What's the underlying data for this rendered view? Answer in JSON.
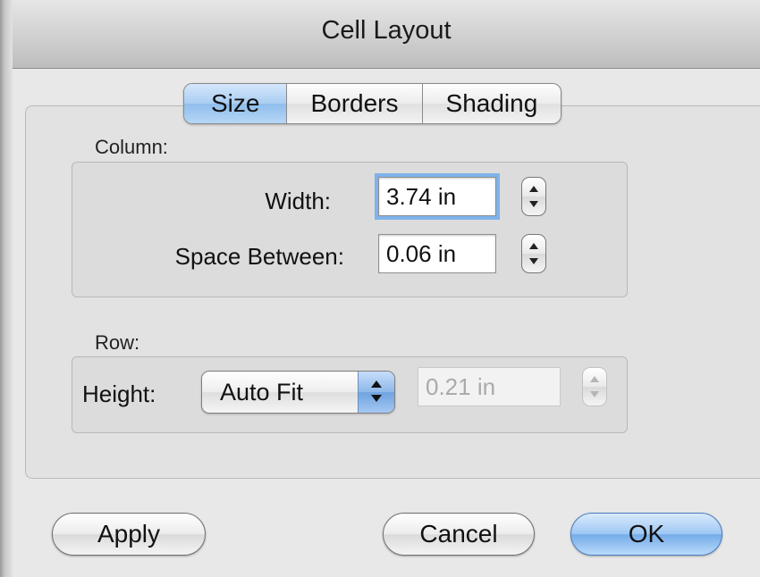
{
  "window": {
    "title": "Cell Layout"
  },
  "tabs": [
    {
      "label": "Size",
      "active": true
    },
    {
      "label": "Borders",
      "active": false
    },
    {
      "label": "Shading",
      "active": false
    }
  ],
  "column": {
    "label": "Column:",
    "width": {
      "label": "Width:",
      "value": "3.74 in"
    },
    "space_between": {
      "label": "Space Between:",
      "value": "0.06 in"
    }
  },
  "row": {
    "label": "Row:",
    "height": {
      "label": "Height:",
      "mode": "Auto Fit",
      "value": "0.21 in"
    }
  },
  "buttons": {
    "apply": "Apply",
    "cancel": "Cancel",
    "ok": "OK"
  },
  "colors": {
    "accent": "#8fbdec",
    "focus_ring": "#7fb2ea"
  },
  "icons": {
    "stepper": "stepper-arrows-icon",
    "popup": "popup-arrows-icon"
  }
}
